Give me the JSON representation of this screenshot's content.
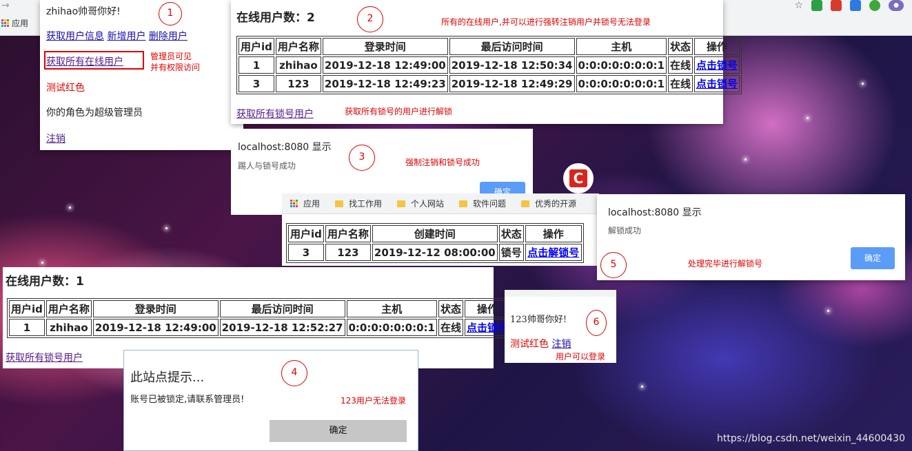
{
  "browser": {
    "apps_label": "应用",
    "bookmarks": [
      "找工作用",
      "个人网站",
      "软件问题",
      "优秀的开源"
    ]
  },
  "panel1": {
    "greeting": "zhihao帅哥你好!",
    "links": [
      "获取用户信息",
      "新增用户",
      "删除用户"
    ],
    "online_link": "获取所有在线用户",
    "note_lines": [
      "管理员可见",
      "并有权限访问"
    ],
    "red_text": "测试红色",
    "role_text": "你的角色为超级管理员",
    "logout": "注销",
    "badge": "1"
  },
  "panel2": {
    "title": "在线用户数：2",
    "badge": "2",
    "note": "所有的在线用户,并可以进行强转注销用户并锁号无法登录",
    "columns": [
      "用户id",
      "用户名称",
      "登录时间",
      "最后访问时间",
      "主机",
      "状态",
      "操作"
    ],
    "rows": [
      [
        "1",
        "zhihao",
        "2019-12-18 12:49:00",
        "2019-12-18 12:50:34",
        "0:0:0:0:0:0:0:1",
        "在线",
        "点击锁号"
      ],
      [
        "3",
        "123",
        "2019-12-18 12:49:23",
        "2019-12-18 12:49:29",
        "0:0:0:0:0:0:0:1",
        "在线",
        "点击锁号"
      ]
    ],
    "locked_link": "获取所有锁号用户",
    "locked_note": "获取所有锁号的用户进行解锁"
  },
  "dialog3": {
    "title": "localhost:8080 显示",
    "message": "踢人与锁号成功",
    "note": "强制注销和锁号成功",
    "badge": "3",
    "ok": "确定"
  },
  "panel_locked": {
    "columns": [
      "用户id",
      "用户名称",
      "创建时间",
      "状态",
      "操作"
    ],
    "rows": [
      [
        "3",
        "123",
        "2019-12-12 08:00:00",
        "锁号",
        "点击解锁号"
      ]
    ]
  },
  "dialog5": {
    "title": "localhost:8080 显示",
    "message": "解锁成功",
    "note": "处理完毕进行解锁号",
    "badge": "5",
    "ok": "确定"
  },
  "panel_online1": {
    "title": "在线用户数：1",
    "columns": [
      "用户id",
      "用户名称",
      "登录时间",
      "最后访问时间",
      "主机",
      "状态",
      "操作"
    ],
    "rows": [
      [
        "1",
        "zhihao",
        "2019-12-18 12:49:00",
        "2019-12-18 12:52:27",
        "0:0:0:0:0:0:0:1",
        "在线",
        "点击锁号"
      ]
    ],
    "locked_link": "获取所有锁号用户"
  },
  "dialog4": {
    "title": "此站点提示...",
    "message": "账号已被锁定,请联系管理员!",
    "note": "123用户无法登录",
    "badge": "4",
    "ok": "确定"
  },
  "panel6": {
    "greeting": "123帅哥你好!",
    "red_text": "测试红色",
    "logout": "注销",
    "note": "用户可以登录",
    "badge": "6"
  },
  "watermark": "https://blog.csdn.net/weixin_44600430"
}
